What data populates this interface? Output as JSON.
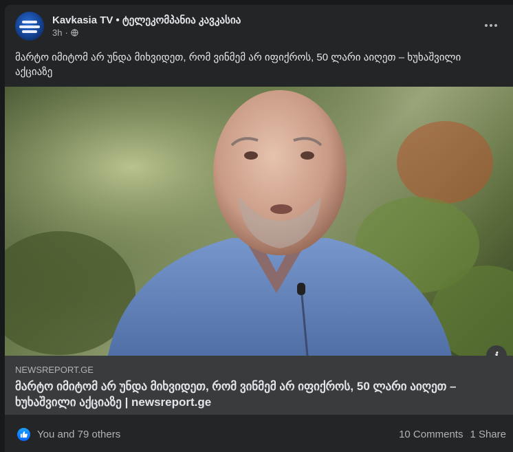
{
  "post": {
    "page_name": "Kavkasia TV • ტელეკომპანია კავკასია",
    "time": "3h",
    "audience_icon": "globe-icon",
    "more_icon": "more-options-icon",
    "caption": "მარტო იმიტომ არ უნდა მიხვიდეთ, რომ ვინმემ არ იფიქროს, 50 ლარი აიღეთ – ხუხაშვილი აქციაზე"
  },
  "link_preview": {
    "domain": "NEWSREPORT.GE",
    "title": "მარტო იმიტომ არ უნდა მიხვიდეთ, რომ ვინმემ არ იფიქროს, 50 ლარი აიღეთ – ხუხაშვილი აქციაზე | newsreport.ge",
    "info_icon_glyph": "i"
  },
  "footer": {
    "reactions_icon": "like-icon",
    "reactors_text": "You and 79 others",
    "comments_text": "10 Comments",
    "shares_text": "1 Share"
  },
  "colors": {
    "card_bg": "#242526",
    "link_bg": "#3a3b3c",
    "like_blue": "#0866ff",
    "shirt_blue": "#6f8fc4"
  }
}
